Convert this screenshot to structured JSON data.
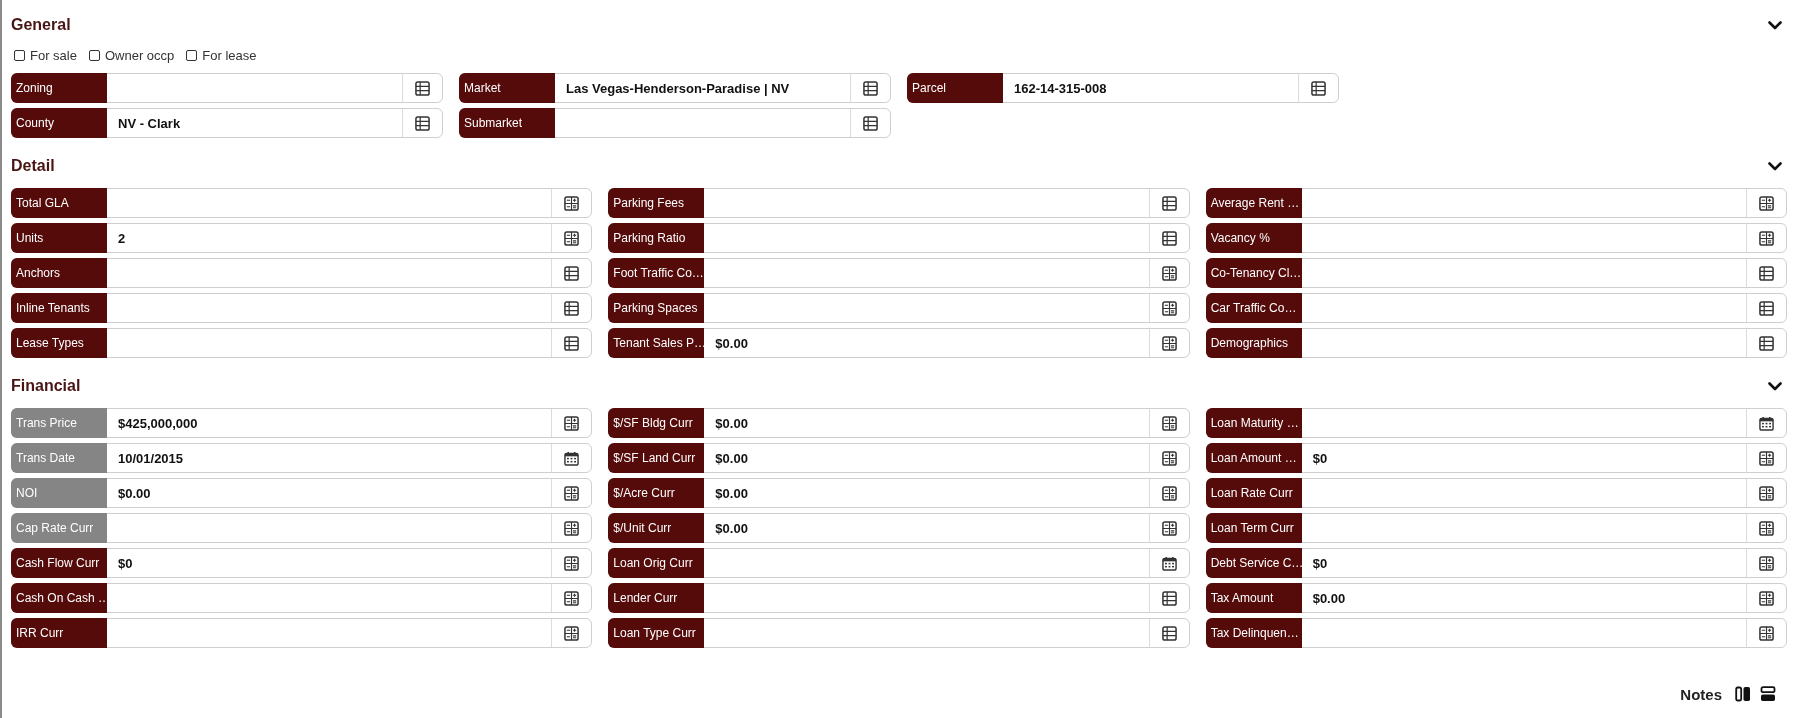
{
  "sections": [
    {
      "title": "General",
      "expanded": true,
      "checkboxes": [
        {
          "label": "For sale",
          "checked": false
        },
        {
          "label": "Owner occp",
          "checked": false
        },
        {
          "label": "For lease",
          "checked": false
        }
      ],
      "columns": [
        [
          {
            "label": "Zoning",
            "kind": "list",
            "greyed": false
          },
          {
            "label": "County",
            "value": "NV - Clark",
            "kind": "list",
            "greyed": false
          }
        ],
        [
          {
            "label": "Market",
            "value": "Las Vegas-Henderson-Paradise | NV",
            "kind": "list",
            "greyed": false
          },
          {
            "label": "Submarket",
            "kind": "list",
            "greyed": false
          }
        ],
        [
          {
            "label": "Parcel",
            "value": "162-14-315-008",
            "kind": "list",
            "greyed": false
          }
        ]
      ]
    },
    {
      "title": "Detail",
      "expanded": true,
      "columns": [
        [
          {
            "label": "Total GLA",
            "kind": "number",
            "greyed": false
          },
          {
            "label": "Units",
            "value": "2",
            "kind": "number",
            "greyed": false
          },
          {
            "label": "Anchors",
            "kind": "list",
            "greyed": false
          },
          {
            "label": "Inline Tenants",
            "kind": "list",
            "greyed": false
          },
          {
            "label": "Lease Types",
            "kind": "list",
            "greyed": false
          }
        ],
        [
          {
            "label": "Parking Fees",
            "kind": "list",
            "greyed": false
          },
          {
            "label": "Parking Ratio",
            "kind": "list",
            "greyed": false
          },
          {
            "label": "Foot Traffic Co…",
            "kind": "number",
            "greyed": false
          },
          {
            "label": "Parking Spaces",
            "kind": "number",
            "greyed": false
          },
          {
            "label": "Tenant Sales P…",
            "value": "$0.00",
            "kind": "number",
            "greyed": false
          }
        ],
        [
          {
            "label": "Average Rent …",
            "kind": "number",
            "greyed": false
          },
          {
            "label": "Vacancy %",
            "kind": "number",
            "greyed": false
          },
          {
            "label": "Co-Tenancy Cl…",
            "kind": "list",
            "greyed": false
          },
          {
            "label": "Car Traffic Co…",
            "kind": "list",
            "greyed": false
          },
          {
            "label": "Demographics",
            "kind": "list",
            "greyed": false
          }
        ]
      ]
    },
    {
      "title": "Financial",
      "expanded": true,
      "columns": [
        [
          {
            "label": "Trans Price",
            "value": "$425,000,000",
            "kind": "number",
            "greyed": true
          },
          {
            "label": "Trans Date",
            "value": "10/01/2015",
            "kind": "date",
            "greyed": true
          },
          {
            "label": "NOI",
            "value": "$0.00",
            "kind": "number",
            "greyed": true
          },
          {
            "label": "Cap Rate Curr",
            "kind": "number",
            "greyed": true
          },
          {
            "label": "Cash Flow Curr",
            "value": "$0",
            "kind": "number",
            "greyed": false
          },
          {
            "label": "Cash On Cash …",
            "kind": "number",
            "greyed": false
          },
          {
            "label": "IRR Curr",
            "kind": "number",
            "greyed": false
          }
        ],
        [
          {
            "label": "$/SF Bldg Curr",
            "value": "$0.00",
            "kind": "number",
            "greyed": false
          },
          {
            "label": "$/SF Land Curr",
            "value": "$0.00",
            "kind": "number",
            "greyed": false
          },
          {
            "label": "$/Acre Curr",
            "value": "$0.00",
            "kind": "number",
            "greyed": false
          },
          {
            "label": "$/Unit Curr",
            "value": "$0.00",
            "kind": "number",
            "greyed": false
          },
          {
            "label": "Loan Orig Curr",
            "kind": "date",
            "greyed": false
          },
          {
            "label": "Lender Curr",
            "kind": "list",
            "greyed": false
          },
          {
            "label": "Loan Type Curr",
            "kind": "list",
            "greyed": false
          }
        ],
        [
          {
            "label": "Loan Maturity …",
            "kind": "date",
            "greyed": false
          },
          {
            "label": "Loan Amount …",
            "value": "$0",
            "kind": "number",
            "greyed": false
          },
          {
            "label": "Loan Rate Curr",
            "kind": "number",
            "greyed": false
          },
          {
            "label": "Loan Term Curr",
            "kind": "number",
            "greyed": false
          },
          {
            "label": "Debt Service C…",
            "value": "$0",
            "kind": "number",
            "greyed": false
          },
          {
            "label": "Tax Amount",
            "value": "$0.00",
            "kind": "number",
            "greyed": false
          },
          {
            "label": "Tax Delinquen…",
            "kind": "number",
            "greyed": false
          }
        ]
      ]
    }
  ],
  "notes_bar": {
    "title": "Notes"
  }
}
